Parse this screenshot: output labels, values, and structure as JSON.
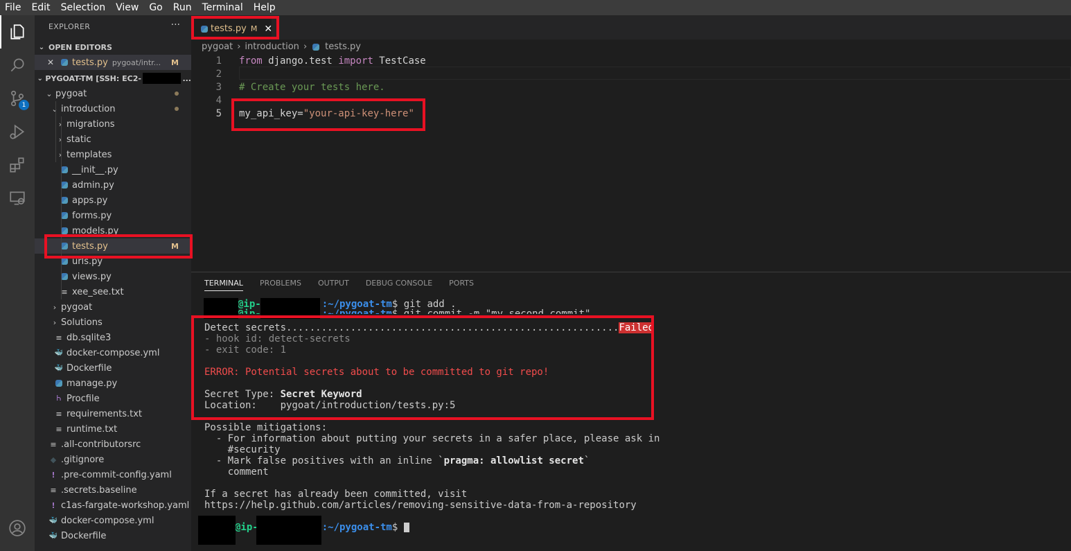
{
  "menubar": {
    "items": [
      "File",
      "Edit",
      "Selection",
      "View",
      "Go",
      "Run",
      "Terminal",
      "Help"
    ]
  },
  "activity_bar": {
    "items": [
      "explorer-icon",
      "search-icon",
      "source-control-icon",
      "run-debug-icon",
      "extensions-icon",
      "remote-explorer-icon"
    ],
    "scm_badge": "1",
    "bottom": "account-icon"
  },
  "sidebar": {
    "title": "EXPLORER",
    "more": "···",
    "open_editors": {
      "header": "OPEN EDITORS",
      "item": {
        "close": "✕",
        "name": "tests.py",
        "path": "pygoat/intr...",
        "status": "M"
      }
    },
    "workspace": {
      "header": "PYGOAT-TM [SSH: EC2-",
      "ellipsis": "..."
    },
    "tree": [
      {
        "label": "pygoat",
        "kind": "folder",
        "open": true,
        "depth": 1,
        "dot": true
      },
      {
        "label": "introduction",
        "kind": "folder",
        "open": true,
        "depth": 2,
        "dot": true
      },
      {
        "label": "migrations",
        "kind": "folder",
        "open": false,
        "depth": 3
      },
      {
        "label": "static",
        "kind": "folder",
        "open": false,
        "depth": 3
      },
      {
        "label": "templates",
        "kind": "folder",
        "open": false,
        "depth": 3
      },
      {
        "label": "__init__.py",
        "kind": "py",
        "depth": 3
      },
      {
        "label": "admin.py",
        "kind": "py",
        "depth": 3
      },
      {
        "label": "apps.py",
        "kind": "py",
        "depth": 3
      },
      {
        "label": "forms.py",
        "kind": "py",
        "depth": 3
      },
      {
        "label": "models.py",
        "kind": "py",
        "depth": 3
      },
      {
        "label": "tests.py",
        "kind": "py",
        "depth": 3,
        "status": "M",
        "selected": true
      },
      {
        "label": "urls.py",
        "kind": "py",
        "depth": 3
      },
      {
        "label": "views.py",
        "kind": "py",
        "depth": 3
      },
      {
        "label": "xee_see.txt",
        "kind": "txt",
        "depth": 3
      },
      {
        "label": "pygoat",
        "kind": "folder",
        "open": false,
        "depth": 2
      },
      {
        "label": "Solutions",
        "kind": "folder",
        "open": false,
        "depth": 2
      },
      {
        "label": "db.sqlite3",
        "kind": "txt",
        "depth": 2
      },
      {
        "label": "docker-compose.yml",
        "kind": "docker",
        "depth": 2
      },
      {
        "label": "Dockerfile",
        "kind": "docker",
        "depth": 2
      },
      {
        "label": "manage.py",
        "kind": "py",
        "depth": 2
      },
      {
        "label": "Procfile",
        "kind": "heroku",
        "depth": 2
      },
      {
        "label": "requirements.txt",
        "kind": "txt",
        "depth": 2
      },
      {
        "label": "runtime.txt",
        "kind": "txt",
        "depth": 2
      },
      {
        "label": ".all-contributorsrc",
        "kind": "txt",
        "depth": 1
      },
      {
        "label": ".gitignore",
        "kind": "git",
        "depth": 1
      },
      {
        "label": ".pre-commit-config.yaml",
        "kind": "yaml",
        "depth": 1
      },
      {
        "label": ".secrets.baseline",
        "kind": "txt",
        "depth": 1
      },
      {
        "label": "c1as-fargate-workshop.yaml",
        "kind": "yaml",
        "depth": 1
      },
      {
        "label": "docker-compose.yml",
        "kind": "docker-red",
        "depth": 1
      },
      {
        "label": "Dockerfile",
        "kind": "docker",
        "depth": 1
      }
    ]
  },
  "editor": {
    "tab": {
      "name": "tests.py",
      "status": "M",
      "close": "✕"
    },
    "breadcrumb": [
      "pygoat",
      "introduction",
      "tests.py"
    ],
    "lines": [
      {
        "n": "1",
        "kw1": "from",
        "t1": " django.test ",
        "kw2": "import",
        "t2": " TestCase"
      },
      {
        "n": "2"
      },
      {
        "n": "3",
        "comment": "# Create your tests here."
      },
      {
        "n": "4"
      },
      {
        "n": "5",
        "var": "my_api_key",
        "eq": "=",
        "str": "\"your-api-key-here\""
      }
    ]
  },
  "panel": {
    "tabs": [
      "TERMINAL",
      "PROBLEMS",
      "OUTPUT",
      "DEBUG CONSOLE",
      "PORTS"
    ],
    "terminal": {
      "prompt_host": "@ip-",
      "prompt_path": ":~/pygoat-tm",
      "prompt_end": "$ ",
      "cmd1": "git add .",
      "cmd2": "git commit -m \"my second commit\"",
      "detect": "Detect secrets.........................................................",
      "failed": "Failed",
      "hook_id": "- hook id: detect-secrets",
      "exit_code": "- exit code: 1",
      "error": "ERROR: Potential secrets about to be committed to git repo!",
      "secret_type_label": "Secret Type: ",
      "secret_type": "Secret Keyword",
      "location_label": "Location:    ",
      "location": "pygoat/introduction/tests.py:5",
      "mitigations": "Possible mitigations:",
      "mit1": "  - For information about putting your secrets in a safer place, please ask in",
      "mit1b": "    #security",
      "mit2a": "  - Mark false positives with an inline `",
      "mit2b": "pragma: allowlist secret",
      "mit2c": "`",
      "mit2d": "    comment",
      "visit": "If a secret has already been committed, visit",
      "url": "https://help.github.com/articles/removing-sensitive-data-from-a-repository"
    }
  }
}
